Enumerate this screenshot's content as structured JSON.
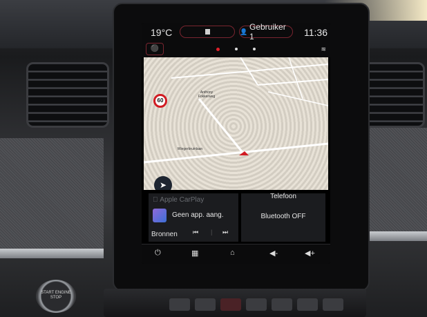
{
  "status_bar": {
    "temperature": "19°C",
    "user": "Gebruiker 1",
    "time": "11:36"
  },
  "map": {
    "speed_limit": "60",
    "street_1": "Anthony Fokkerweg",
    "street_2": "Wiegerbruinlaan"
  },
  "carplay": {
    "title": "Apple CarPlay",
    "now_playing": "Geen app. aang.",
    "sources_label": "Bronnen"
  },
  "phone": {
    "title": "Telefoon",
    "status": "Bluetooth OFF"
  },
  "start_button": {
    "label": "START ENGINE STOP"
  },
  "icons": {
    "back": "back-icon",
    "apps": "apps-grid-icon",
    "home": "home-icon",
    "volume_down": "volume-down-icon",
    "volume_up": "volume-up-icon"
  },
  "colors": {
    "accent": "#7a2530",
    "active_dot": "#e0202a",
    "speed_ring": "#d11b22"
  }
}
